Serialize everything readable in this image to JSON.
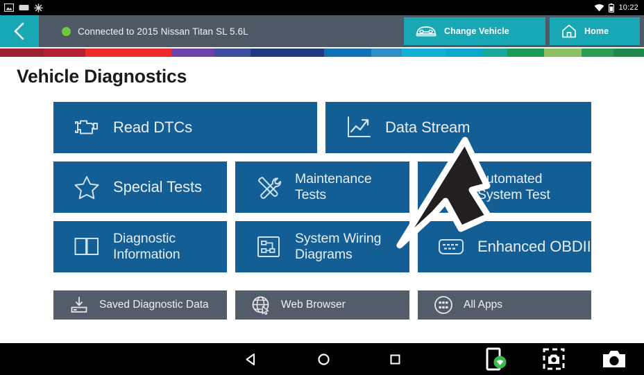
{
  "status_bar": {
    "time": "10:22",
    "left_icons": [
      "image-icon",
      "screenshot-icon",
      "snowflake-icon"
    ],
    "right_icons": [
      "wifi-icon",
      "battery-icon"
    ]
  },
  "header": {
    "back_icon": "chevron-left-icon",
    "connection_status": "Connected to 2015 Nissan Titan SL 5.6L",
    "connection_dot_color": "#73c73b",
    "background_color": "#4f5965",
    "accent_color": "#18a7b5",
    "change_vehicle_label": "Change Vehicle",
    "change_vehicle_icon": "car-icon",
    "home_label": "Home",
    "home_icon": "home-icon"
  },
  "stripe_colors": [
    "#9c1f33",
    "#b22234",
    "#ee2a2a",
    "#6c40a8",
    "#3a4e9e",
    "#1e3b82",
    "#1071b5",
    "#2e8fc4",
    "#12b0d6",
    "#0aa8cd",
    "#16a99b",
    "#1c9b52",
    "#8cc163",
    "#2b9e54",
    "#1f8a4c"
  ],
  "main": {
    "title": "Vehicle Diagnostics",
    "tile_color": "#135e95",
    "util_color": "#525d69",
    "tiles": [
      {
        "label": "Read DTCs",
        "icon": "engine-icon",
        "two_line": false
      },
      {
        "label": "Data Stream",
        "icon": "line-chart-icon",
        "two_line": false
      },
      {
        "label": "Special Tests",
        "icon": "star-icon",
        "two_line": false
      },
      {
        "label": "Maintenance\nTests",
        "icon": "tools-icon",
        "two_line": true
      },
      {
        "label": "Automated\nSystem Test",
        "icon": "checklist-icon",
        "two_line": true
      },
      {
        "label": "Diagnostic\nInformation",
        "icon": "open-book-icon",
        "two_line": true
      },
      {
        "label": "System Wiring\nDiagrams",
        "icon": "wiring-diagram-icon",
        "two_line": true
      },
      {
        "label": "Enhanced OBDII",
        "icon": "obd-connector-icon",
        "two_line": false
      }
    ],
    "utilities": [
      {
        "label": "Saved Diagnostic Data",
        "icon": "save-download-icon"
      },
      {
        "label": "Web Browser",
        "icon": "globe-cursor-icon"
      },
      {
        "label": "All Apps",
        "icon": "apps-grid-icon"
      }
    ]
  },
  "cursor": {
    "name": "pointer-arrow",
    "target": "Automated System Test"
  },
  "nav_bar": {
    "system_buttons": [
      {
        "name": "back-nav-button",
        "icon": "triangle-left-icon"
      },
      {
        "name": "home-nav-button",
        "icon": "circle-icon"
      },
      {
        "name": "recents-nav-button",
        "icon": "square-icon"
      }
    ],
    "extra_buttons": [
      {
        "name": "device-wifi-button",
        "icon": "tablet-wifi-icon"
      },
      {
        "name": "screenshot-region-button",
        "icon": "screenshot-crop-icon"
      },
      {
        "name": "camera-button",
        "icon": "camera-icon"
      }
    ]
  }
}
